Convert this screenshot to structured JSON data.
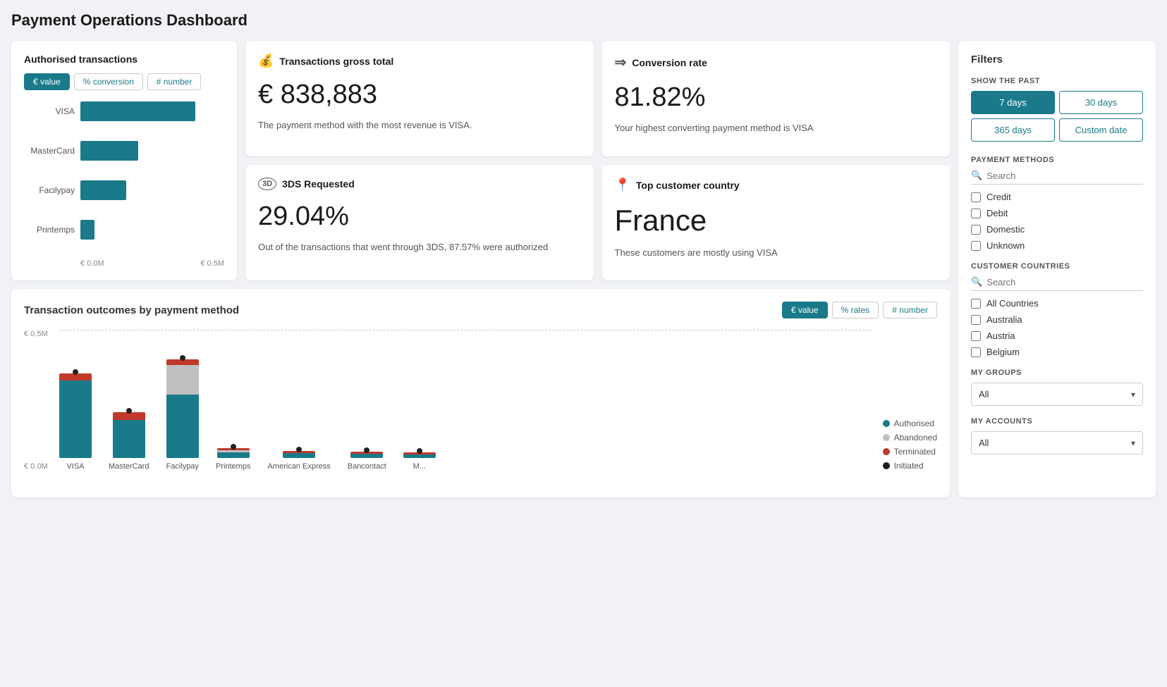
{
  "page": {
    "title": "Payment Operations Dashboard"
  },
  "authorised": {
    "card_title": "Authorised transactions",
    "toggle_value": "€ value",
    "toggle_conversion": "% conversion",
    "toggle_number": "# number",
    "active_toggle": "value",
    "bars": [
      {
        "label": "VISA",
        "pct": 80
      },
      {
        "label": "MasterCard",
        "pct": 40
      },
      {
        "label": "Facilypay",
        "pct": 32
      },
      {
        "label": "Printemps",
        "pct": 10
      }
    ],
    "axis_min": "€ 0.0M",
    "axis_max": "€ 0.5M"
  },
  "gross": {
    "icon": "💰",
    "card_title": "Transactions gross total",
    "value": "€ 838,883",
    "description": "The payment method with the most revenue is VISA."
  },
  "conversion": {
    "icon": "→",
    "card_title": "Conversion rate",
    "value": "81.82%",
    "description": "Your highest converting payment method is VISA"
  },
  "tds": {
    "card_title": "3DS Requested",
    "value": "29.04%",
    "description": "Out of the transactions that went through 3DS, 87.57% were authorized"
  },
  "top_country": {
    "card_title": "Top customer country",
    "value": "France",
    "description": "These customers are mostly using VISA"
  },
  "filters": {
    "title": "Filters",
    "show_past_label": "SHOW THE PAST",
    "btn_7days": "7 days",
    "btn_30days": "30 days",
    "btn_365days": "365 days",
    "btn_custom": "Custom date",
    "active_period": "7days",
    "payment_methods_label": "PAYMENT METHODS",
    "payment_search_placeholder": "Search",
    "payment_options": [
      "Credit",
      "Debit",
      "Domestic",
      "Unknown"
    ],
    "countries_label": "CUSTOMER COUNTRIES",
    "country_search_placeholder": "Search",
    "country_options": [
      "All Countries",
      "Australia",
      "Austria",
      "Belgium"
    ],
    "my_groups_label": "MY GROUPS",
    "my_groups_value": "All",
    "my_accounts_label": "MY ACCOUNTS",
    "my_accounts_value": "All"
  },
  "outcomes": {
    "title": "Transaction outcomes by payment method",
    "toggle_value": "€ value",
    "toggle_rates": "% rates",
    "toggle_number": "# number",
    "active_toggle": "value",
    "y_top": "€ 0.5M",
    "y_bottom": "€ 0.0M",
    "bars": [
      {
        "label": "VISA",
        "authorized": 120,
        "abandoned": 0,
        "terminated": 14
      },
      {
        "label": "MasterCard",
        "authorized": 60,
        "abandoned": 0,
        "terminated": 12
      },
      {
        "label": "Facilypay",
        "authorized": 90,
        "abandoned": 45,
        "terminated": 10
      },
      {
        "label": "Printemps",
        "authorized": 8,
        "abandoned": 2,
        "terminated": 3
      },
      {
        "label": "American Express",
        "authorized": 5,
        "abandoned": 1,
        "terminated": 2
      },
      {
        "label": "Bancontact",
        "authorized": 4,
        "abandoned": 1,
        "terminated": 1
      },
      {
        "label": "M...",
        "authorized": 3,
        "abandoned": 1,
        "terminated": 1
      }
    ],
    "legend": [
      {
        "label": "Authorised",
        "color": "#1a7a8a"
      },
      {
        "label": "Abandoned",
        "color": "#c0c0c0"
      },
      {
        "label": "Terminated",
        "color": "#c0392b"
      },
      {
        "label": "Initiated",
        "color": "#1a1a1a"
      }
    ]
  }
}
